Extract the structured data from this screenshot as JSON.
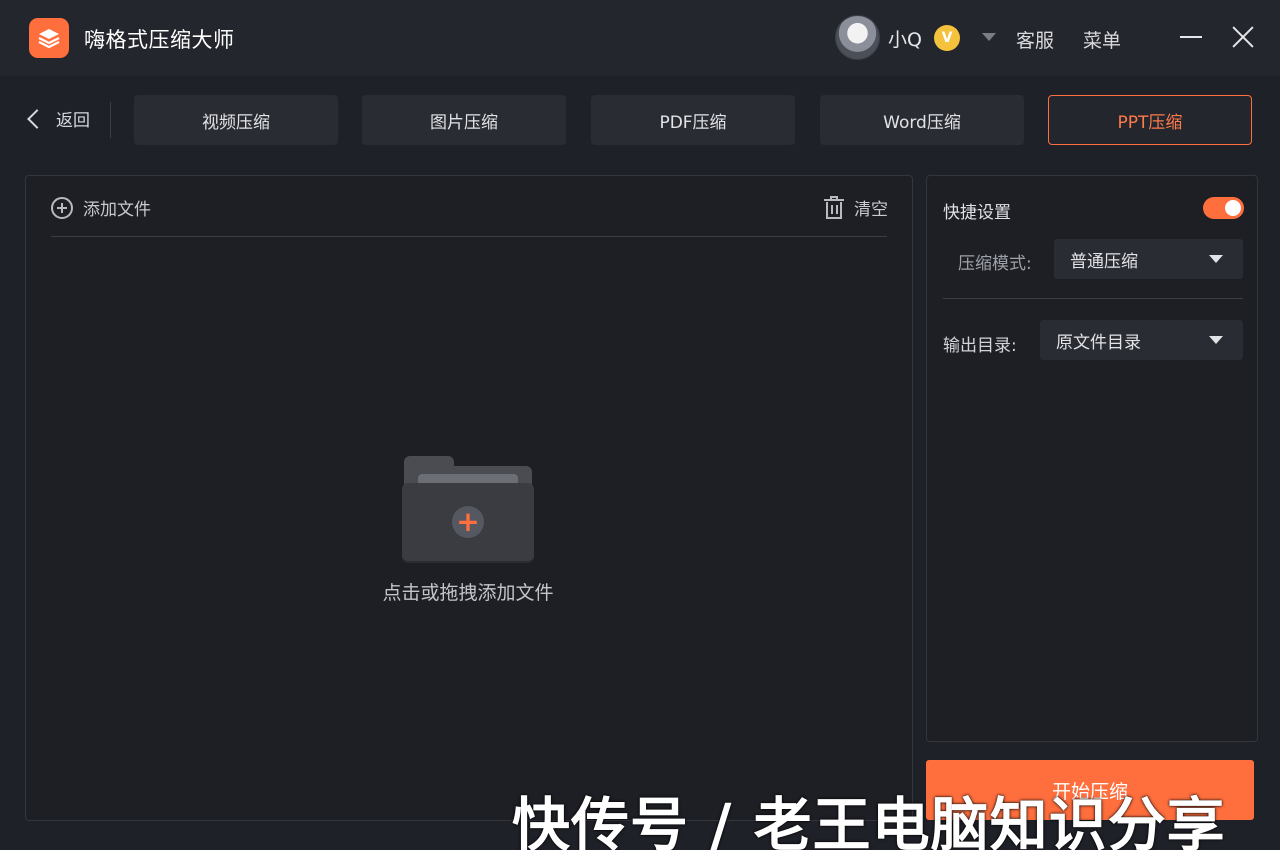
{
  "app": {
    "title": "嗨格式压缩大师"
  },
  "user": {
    "name": "小Q",
    "badge": "V"
  },
  "header": {
    "support": "客服",
    "menu": "菜单"
  },
  "nav": {
    "back": "返回",
    "tabs": [
      {
        "label": "视频压缩",
        "active": false
      },
      {
        "label": "图片压缩",
        "active": false
      },
      {
        "label": "PDF压缩",
        "active": false
      },
      {
        "label": "Word压缩",
        "active": false
      },
      {
        "label": "PPT压缩",
        "active": true
      }
    ]
  },
  "files": {
    "add": "添加文件",
    "clear": "清空",
    "drop_hint": "点击或拖拽添加文件"
  },
  "settings": {
    "quick": "快捷设置",
    "quick_enabled": true,
    "mode_label": "压缩模式:",
    "mode_value": "普通压缩",
    "output_label": "输出目录:",
    "output_value": "原文件目录"
  },
  "actions": {
    "start": "开始压缩"
  },
  "watermark": "快传号 / 老王电脑知识分享",
  "colors": {
    "accent": "#ff6e3d",
    "background": "#1f2128"
  }
}
